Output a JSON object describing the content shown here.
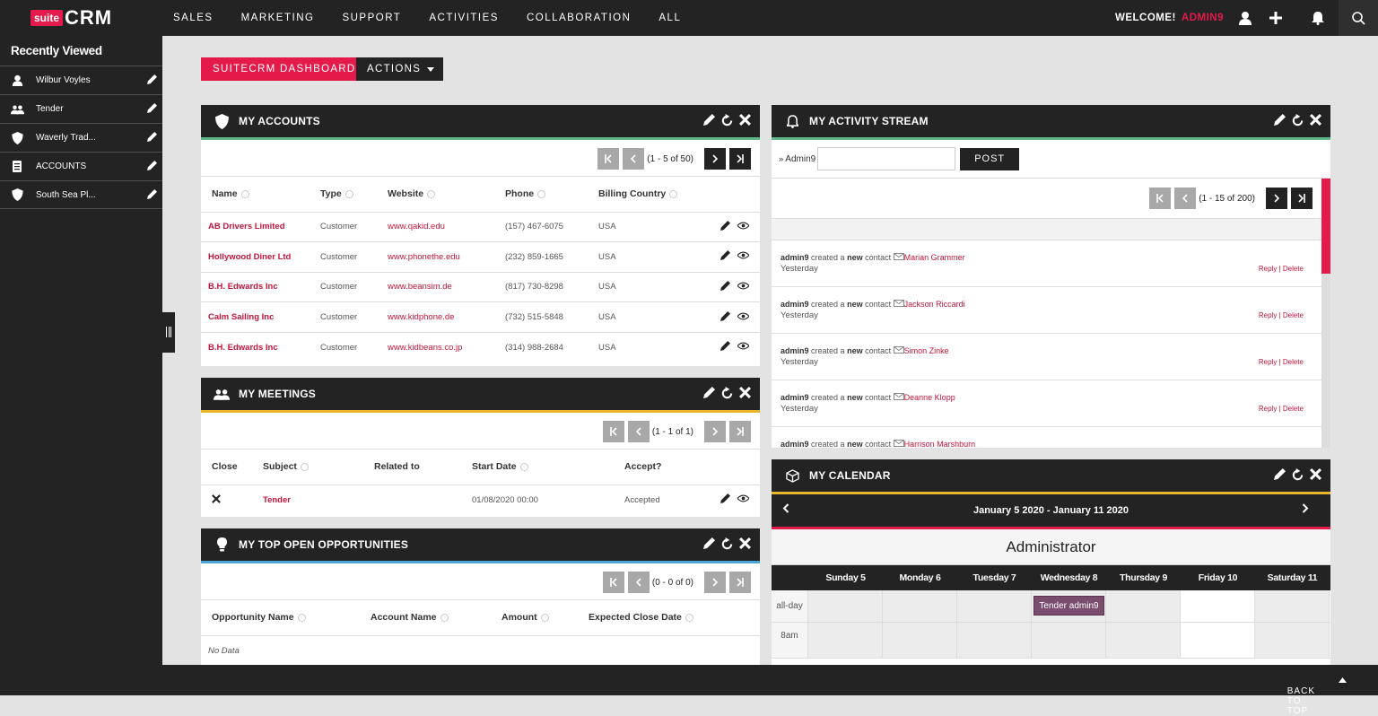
{
  "brand": {
    "suite": "suite",
    "crm": "CRM"
  },
  "nav": [
    "SALES",
    "MARKETING",
    "SUPPORT",
    "ACTIVITIES",
    "COLLABORATION",
    "ALL"
  ],
  "welcome": {
    "label": "WELCOME!",
    "user": "ADMIN9"
  },
  "sidebar": {
    "title": "Recently Viewed",
    "items": [
      {
        "label": "Wilbur Voyles",
        "icon": "person-icon"
      },
      {
        "label": "Tender",
        "icon": "people-icon"
      },
      {
        "label": "Waverly Trad...",
        "icon": "shield-icon"
      },
      {
        "label": "ACCOUNTS",
        "icon": "document-icon"
      },
      {
        "label": "South Sea Pl...",
        "icon": "shield-icon"
      }
    ]
  },
  "buttons": {
    "dashboard": "SUITECRM DASHBOARD",
    "actions": "ACTIONS"
  },
  "accounts": {
    "title": "MY ACCOUNTS",
    "pager": "(1 - 5 of 50)",
    "headers": {
      "name": "Name",
      "type": "Type",
      "website": "Website",
      "phone": "Phone",
      "country": "Billing Country"
    },
    "rows": [
      {
        "name": "AB Drivers Limited",
        "type": "Customer",
        "website": "www.qakid.edu",
        "phone": "(157) 467-6075",
        "country": "USA"
      },
      {
        "name": "Hollywood Diner Ltd",
        "type": "Customer",
        "website": "www.phonethe.edu",
        "phone": "(232) 859-1665",
        "country": "USA"
      },
      {
        "name": "B.H. Edwards Inc",
        "type": "Customer",
        "website": "www.beansim.de",
        "phone": "(817) 730-8298",
        "country": "USA"
      },
      {
        "name": "Calm Sailing Inc",
        "type": "Customer",
        "website": "www.kidphone.de",
        "phone": "(732) 515-5848",
        "country": "USA"
      },
      {
        "name": "B.H. Edwards Inc",
        "type": "Customer",
        "website": "www.kidbeans.co.jp",
        "phone": "(314) 988-2684",
        "country": "USA"
      }
    ]
  },
  "meetings": {
    "title": "MY MEETINGS",
    "pager": "(1 - 1 of 1)",
    "headers": {
      "close": "Close",
      "subject": "Subject",
      "related": "Related to",
      "start": "Start Date",
      "accept": "Accept?"
    },
    "rows": [
      {
        "subject": "Tender",
        "related": "",
        "start": "01/08/2020 00:00",
        "accept": "Accepted"
      }
    ]
  },
  "opportunities": {
    "title": "MY TOP OPEN OPPORTUNITIES",
    "pager": "(0 - 0 of 0)",
    "headers": {
      "name": "Opportunity Name",
      "account": "Account Name",
      "amount": "Amount",
      "close": "Expected Close Date"
    },
    "empty": "No Data"
  },
  "activity": {
    "title": "MY ACTIVITY STREAM",
    "user_label": "Admin9",
    "post_label": "POST",
    "pager": "(1 - 15 of 200)",
    "items": [
      {
        "who": "admin9",
        "verb": "created a",
        "new": "new",
        "what": "contact",
        "link": "Marian Grammer",
        "when": "Yesterday",
        "reply": "Reply",
        "sep": "|",
        "delete": "Delete"
      },
      {
        "who": "admin9",
        "verb": "created a",
        "new": "new",
        "what": "contact",
        "link": "Jackson Riccardi",
        "when": "Yesterday",
        "reply": "Reply",
        "sep": "|",
        "delete": "Delete"
      },
      {
        "who": "admin9",
        "verb": "created a",
        "new": "new",
        "what": "contact",
        "link": "Simon Zinke",
        "when": "Yesterday",
        "reply": "Reply",
        "sep": "|",
        "delete": "Delete"
      },
      {
        "who": "admin9",
        "verb": "created a",
        "new": "new",
        "what": "contact",
        "link": "Deanne Klopp",
        "when": "Yesterday",
        "reply": "Reply",
        "sep": "|",
        "delete": "Delete"
      },
      {
        "who": "admin9",
        "verb": "created a",
        "new": "new",
        "what": "contact",
        "link": "Harrison Marshburn",
        "when": "",
        "reply": "",
        "sep": "",
        "delete": ""
      }
    ]
  },
  "calendar": {
    "title": "MY CALENDAR",
    "range": "January 5 2020 - January 11 2020",
    "owner": "Administrator",
    "days": [
      "Sunday 5",
      "Monday 6",
      "Tuesday 7",
      "Wednesday 8",
      "Thursday 9",
      "Friday 10",
      "Saturday 11"
    ],
    "allday_label": "all-day",
    "hour_label": "8am",
    "event": "Tender admin9"
  },
  "footer": {
    "back_to_top": "BACK TO TOP"
  },
  "colors": {
    "brand": "#e41b4a",
    "dark": "#232323",
    "accounts_stripe": "#5fb98a",
    "meetings_stripe": "#e8b62a",
    "opps_stripe": "#4aa6d8",
    "activity_stripe": "#5fb98a",
    "calendar_stripe": "#e8b62a",
    "event": "#7a4d6e"
  }
}
